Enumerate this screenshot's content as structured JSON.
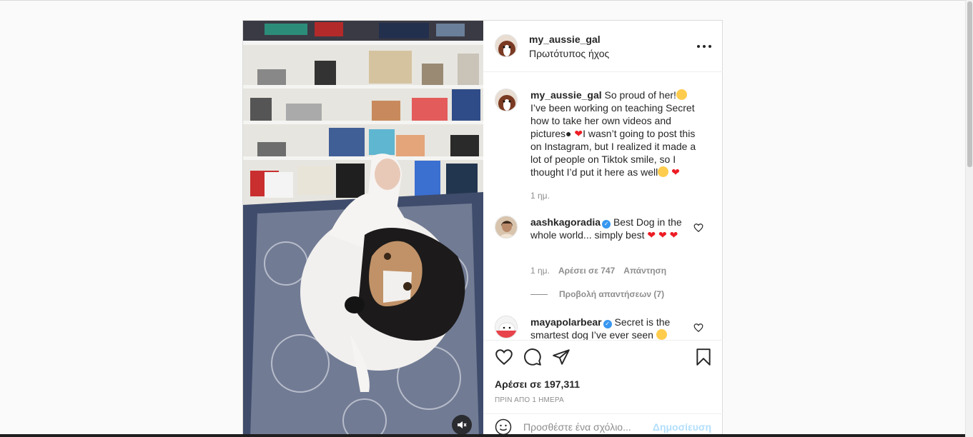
{
  "post": {
    "author": "my_aussie_gal",
    "audio": "Πρωτότυπος ήχος",
    "caption": {
      "username": "my_aussie_gal",
      "part1": "So proud of her!",
      "part2": " I’ve been working on teaching Secret how to take her own videos and pictures",
      "part3": "I wasn’t going to post this on Instagram, but I realized it made a lot of people on Tiktok smile, so I thought I’d put it here as well",
      "time": "1 ημ."
    },
    "comments": [
      {
        "username": "aashkagoradia",
        "text": "Best Dog in the whole world... simply best",
        "time": "1 ημ.",
        "likes": "Αρέσει σε 747",
        "reply": "Απάντηση",
        "view_replies": "Προβολή απαντήσεων (7)"
      },
      {
        "username": "mayapolarbear",
        "text": "Secret is the smartest dog I’ve ever seen"
      }
    ],
    "likes": "Αρέσει σε 197,311",
    "posted": "ΠΡΙΝ ΑΠΟ 1 ΗΜΕΡΑ",
    "comment_placeholder": "Προσθέστε ένα σχόλιο...",
    "post_button": "Δημοσίευση"
  },
  "icons": {
    "more": "more-options-icon",
    "like": "heart-icon",
    "comment": "comment-icon",
    "share": "share-icon",
    "save": "bookmark-icon",
    "emoji": "emoji-icon",
    "mute": "muted-speaker-icon"
  },
  "colors": {
    "link_blue": "#3897f0",
    "post_disabled": "#b2dffc",
    "heart_red": "#ed1c24"
  }
}
